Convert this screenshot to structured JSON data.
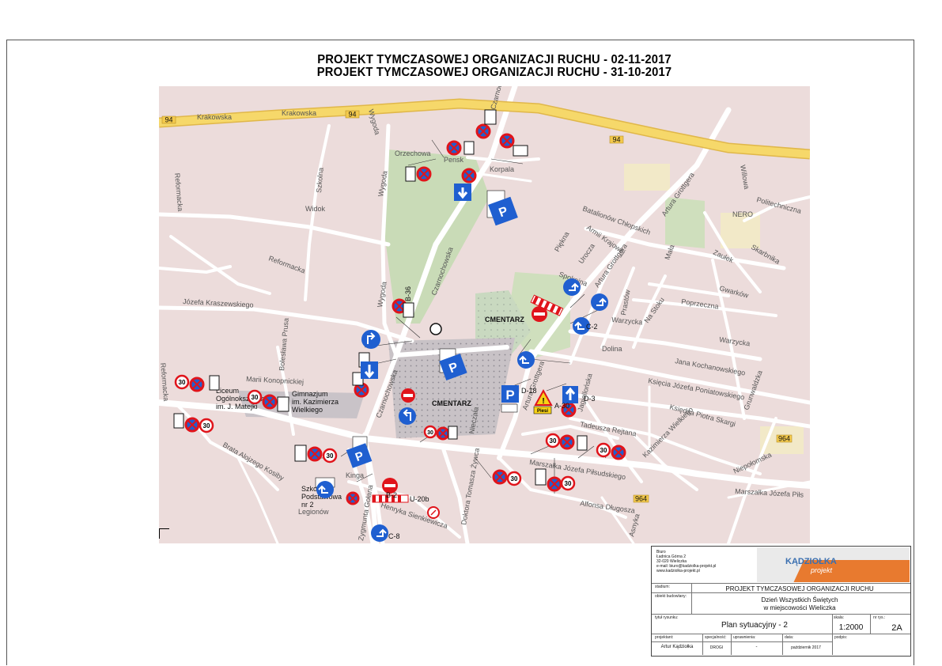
{
  "titles": [
    "PROJEKT  TYMCZASOWEJ  ORGANIZACJI RUCHU -  02-11-2017",
    "PROJEKT  TYMCZASOWEJ  ORGANIZACJI RUCHU -  31-10-2017"
  ],
  "map": {
    "streets": {
      "krakowska": "Krakowska",
      "krakowska2": "Krakowska",
      "route94a": "94",
      "route94b": "94",
      "route94c": "94",
      "route964a": "964",
      "route964b": "964",
      "orzechowa": "Orzechowa",
      "penska": "Pensk",
      "korpala": "Korpala",
      "wygoda1": "Wygoda",
      "wygoda2": "Wygoda",
      "wygoda3": "Wygoda",
      "szkolna": "Szkolna",
      "widok": "Widok",
      "reformacka1": "Reformacka",
      "reformacka2": "Reformacka",
      "reformacka3": "Reformacka",
      "kraszewskiego": "Józefa Kraszewskiego",
      "boleslawa": "Bolesława Prusa",
      "konopnickiej": "Marii Konopnickiej",
      "czarnochowska1": "Czarnochowska",
      "czarnochowska2": "Czarnochowska",
      "czarnochowska3": "Czarnochowska",
      "batalionow": "Batalionów Chłopskich",
      "grottgera1": "Artura Grottgera",
      "grottgera2": "Artura Grottgera",
      "grottgera3": "Artura Grottgera",
      "piekna": "Piękna",
      "armii": "Armii Krajowej",
      "urocza": "Urocza",
      "spokojna": "Spokojna",
      "prastow": "Prastów",
      "nastoku": "Na Stoku",
      "mala": "Mała",
      "wiliowa": "Willowa",
      "politechniczna": "Politechniczna",
      "zaulek": "Zaułek",
      "skarbnika": "Skarbnika",
      "gwarkow": "Gwarków",
      "poprzeczna": "Poprzeczna",
      "warzycka1": "Warzycka",
      "warzycka2": "Warzycka",
      "kochanowskiego": "Jana Kochanowskiego",
      "poniatowskiego": "Księcia Józefa Poniatowskiego",
      "skargi": "Księdza Piotra Skargi",
      "jagiellonska": "Jagiellońska",
      "reitana": "Tadeusza Rejtana",
      "wielkiego": "Kazimierza Wielkiego",
      "grunwaldzka": "Grunwaldzka",
      "niepolomska": "Niepołomska",
      "pilsudskiego1": "Marszałka Józefa Piłsudskiego",
      "pilsudskiego2": "Marszałka Józefa Piłs",
      "dlugosza": "Alfonsa Długosza",
      "asnyka": "Asnyka",
      "zywca": "Doktora Tomasza Żywca",
      "kosiby": "Brata Alojzego Kosiby",
      "kinga": "Kinga",
      "legionow": "Legionów",
      "sienkiewicza": "Henryka Sienkiewicza",
      "zygmunta": "Zygmunta Gołana",
      "neca": "Nieczała",
      "liceum": "Liceum\nOgólnokształcące\nim. J. Matejki",
      "gimnazjum": "Gimnazjum\nim. Kazimierza\nWielkiego",
      "szkola": "Szkoła\nPodstawowa\nnr 2",
      "cmentarz1": "CMENTARZ",
      "cmentarz2": "CMENTARZ",
      "dolina": "Dolina",
      "nero": "NERO"
    },
    "signs": {
      "speed": "30",
      "pieszi": "Piesi",
      "u20b": "U-20b",
      "b36": "B-36",
      "b2": "B-2",
      "c2": "C-2",
      "c8": "C-8",
      "d18": "D-18",
      "d3": "D-3",
      "a30": "A-30",
      "parking": "P"
    }
  },
  "titleblock": {
    "office": [
      "Biuro",
      "Ładnica Górna 2",
      "32-020 Wieliczka",
      "e-mail: biuro@kadziolka-projekt.pl",
      "www.kadziolka-projekt.pl"
    ],
    "brand": "KĄDZIOŁKA",
    "brand_sub": "projekt",
    "stadium_label": "stadium:",
    "stadium_value": "PROJEKT  TYMCZASOWEJ  ORGANIZACJI RUCHU",
    "object_label": "obiekt budowlany:",
    "object_line1": "Dzień Wszystkich Świętych",
    "object_line2": "w miejscowości Wieliczka",
    "drawing_label": "tytuł rysunku:",
    "drawing_value": "Plan sytuacyjny - 2",
    "scale_label": "skala:",
    "scale_value": "1:2000",
    "number_label": "nr rys.:",
    "number_value": "2A",
    "designer_label": "projektant:",
    "designer_value": "Artur Kądziołka",
    "specialty_label": "specjalność:",
    "specialty_value": "DROGI",
    "license_label": "uprawnienia:",
    "license_value": "-",
    "date_label": "data:",
    "date_value": "październik 2017",
    "signature_label": "podpis:"
  },
  "colors": {
    "map_bg": "#ecdcdb",
    "road": "#ffffff",
    "main_road": "#f4cf5a",
    "park": "#c9dcb8",
    "sign_blue": "#1f5fd0",
    "sign_red": "#e0141b"
  }
}
